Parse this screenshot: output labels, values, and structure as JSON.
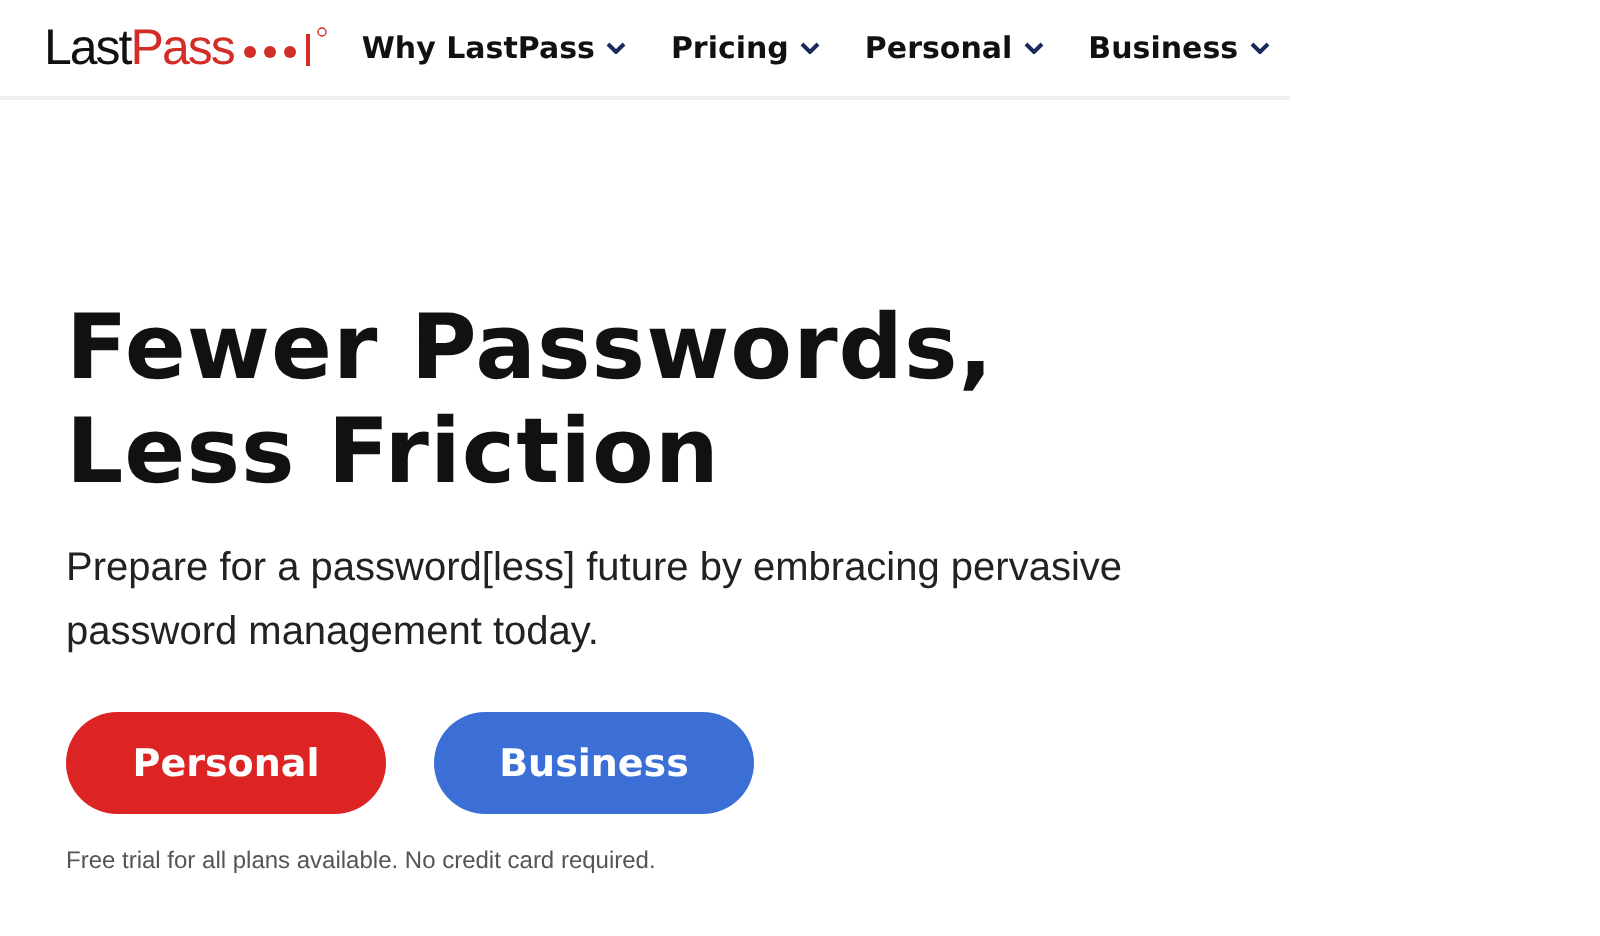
{
  "header": {
    "logo": {
      "first": "Last",
      "second": "Pass"
    },
    "nav": [
      {
        "label": "Why LastPass"
      },
      {
        "label": "Pricing"
      },
      {
        "label": "Personal"
      },
      {
        "label": "Business"
      }
    ]
  },
  "hero": {
    "title_lines": [
      "Fewer Passwords,",
      "Less Friction"
    ],
    "subtitle": "Prepare for a password[less] future by embracing pervasive password management today.",
    "buttons": [
      {
        "label": "Personal",
        "color": "#dd2424"
      },
      {
        "label": "Business",
        "color": "#3b6fd6"
      }
    ],
    "note": "Free trial for all plans available. No credit card required."
  }
}
